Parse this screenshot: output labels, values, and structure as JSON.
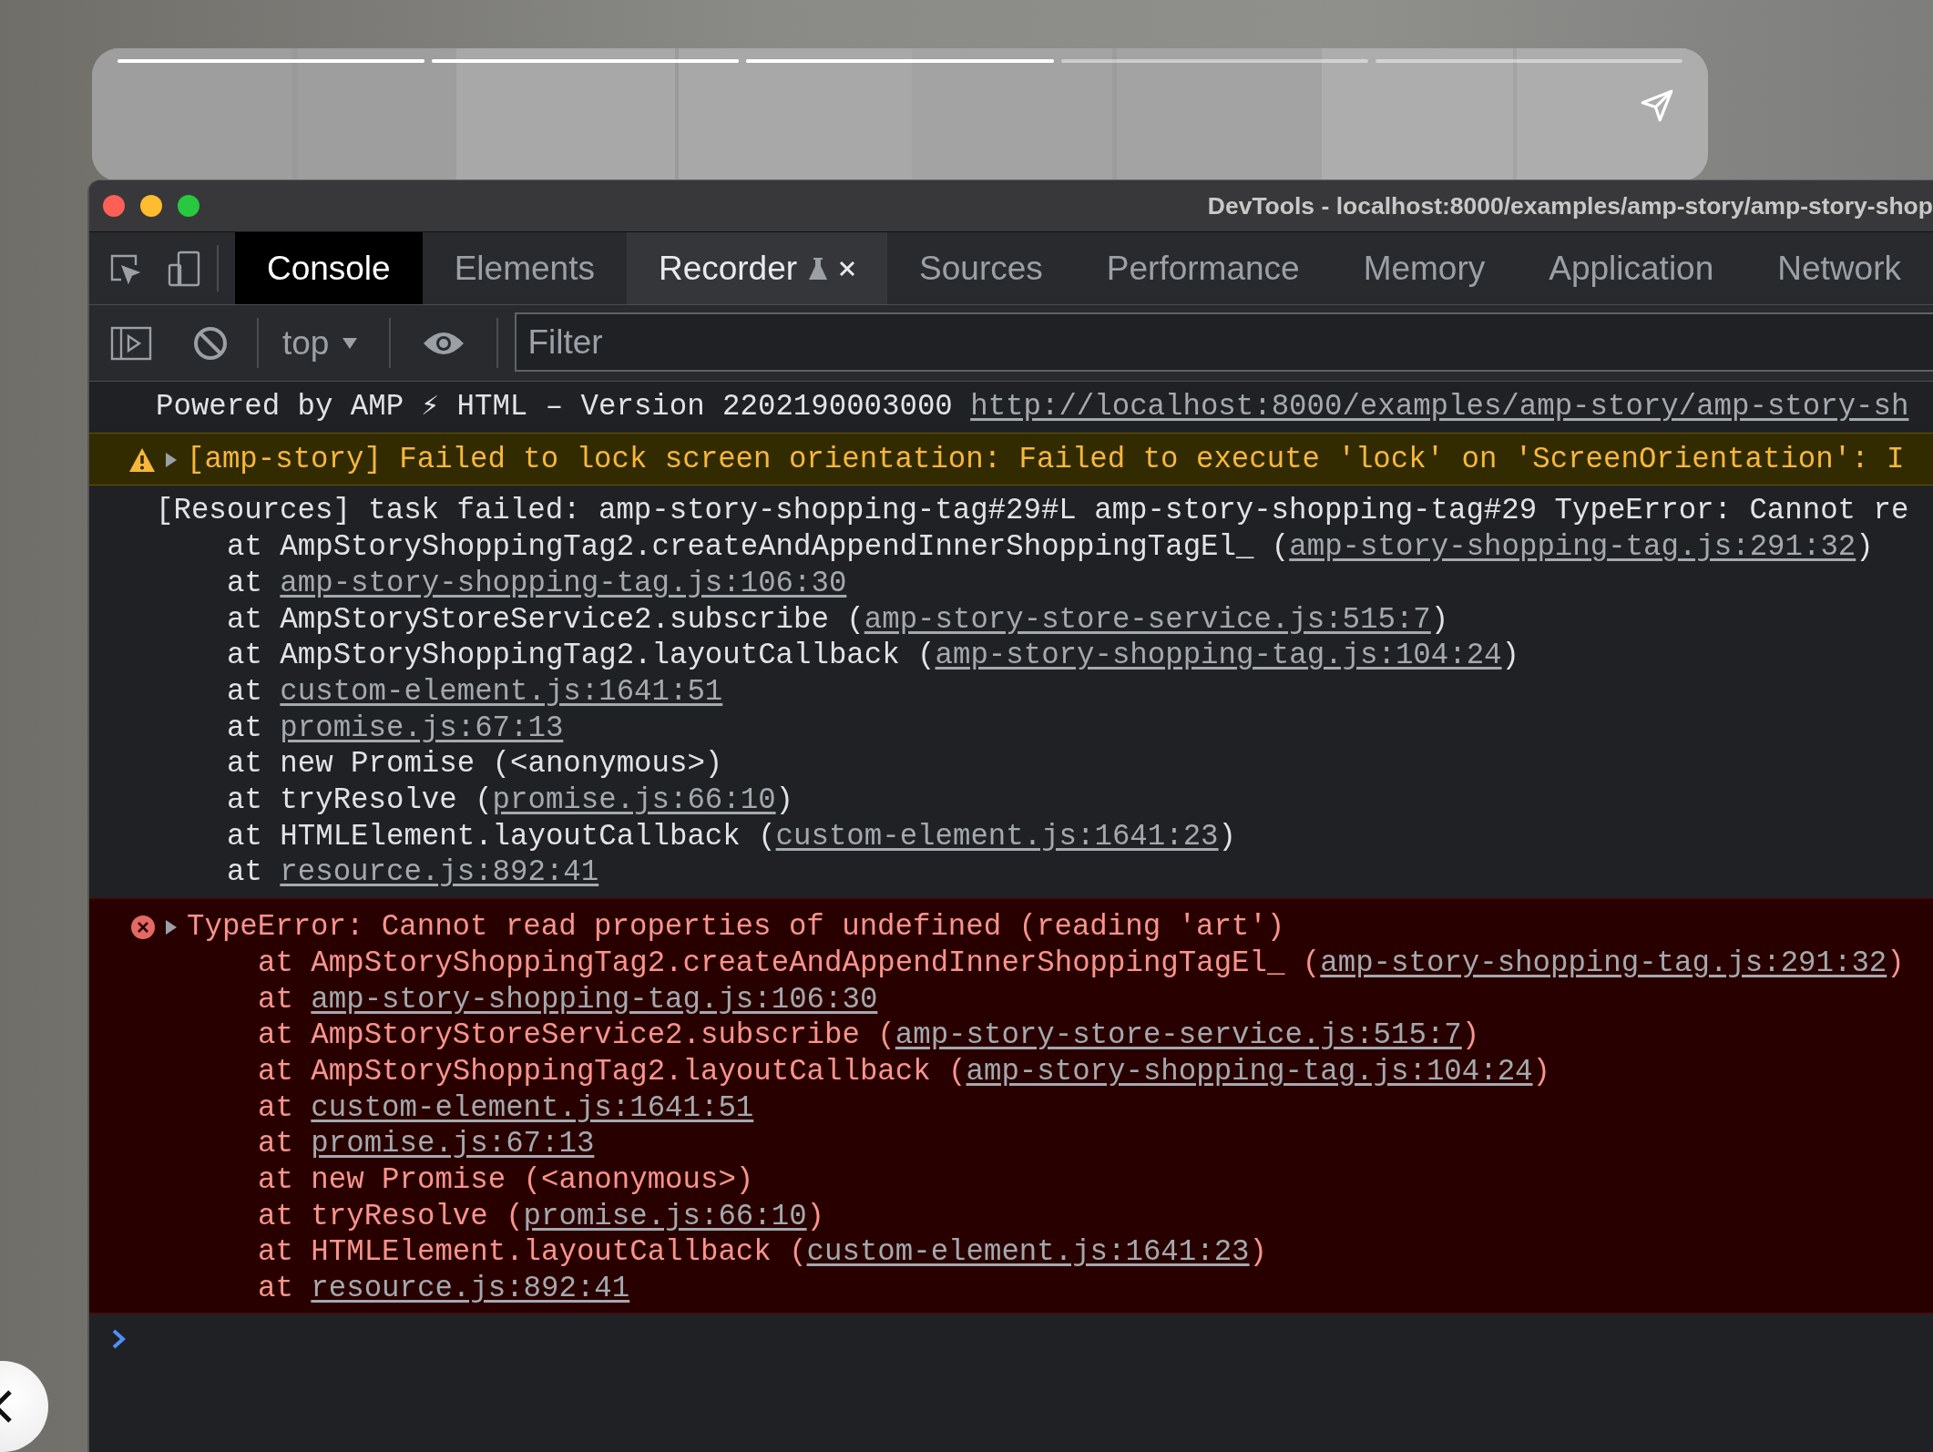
{
  "story": {
    "progress": [
      {
        "level": 1
      },
      {
        "level": 1
      },
      {
        "level": 1
      },
      {
        "level": 0
      },
      {
        "level": 0
      }
    ]
  },
  "devtools": {
    "title": "DevTools - localhost:8000/examples/amp-story/amp-story-shop",
    "tabs": [
      {
        "label": "Console",
        "selected": true,
        "hovered": false
      },
      {
        "label": "Elements",
        "selected": false,
        "hovered": false
      },
      {
        "label": "Recorder",
        "selected": false,
        "hovered": true,
        "experimental": true,
        "closable": true
      },
      {
        "label": "Sources",
        "selected": false,
        "hovered": false
      },
      {
        "label": "Performance",
        "selected": false,
        "hovered": false
      },
      {
        "label": "Memory",
        "selected": false,
        "hovered": false
      },
      {
        "label": "Application",
        "selected": false,
        "hovered": false
      },
      {
        "label": "Network",
        "selected": false,
        "hovered": false
      }
    ],
    "console_toolbar": {
      "context": "top",
      "filter": {
        "placeholder": "Filter"
      }
    },
    "messages": [
      {
        "kind": "info",
        "text": "Powered by AMP ⚡ HTML – Version 2202190003000 ",
        "link": "http://localhost:8000/examples/amp-story/amp-story-sh"
      },
      {
        "kind": "warning",
        "expanded": false,
        "text": "[amp-story] Failed to lock screen orientation: Failed to execute 'lock' on 'ScreenOrientation': I"
      },
      {
        "kind": "info",
        "text": "[Resources] task failed: amp-story-shopping-tag#29#L amp-story-shopping-tag#29 TypeError: Cannot re",
        "stack": [
          {
            "before": "at AmpStoryShoppingTag2.createAndAppendInnerShoppingTagEl_ (",
            "link": "amp-story-shopping-tag.js:291:32",
            "after": ")"
          },
          {
            "before": "at ",
            "link": "amp-story-shopping-tag.js:106:30"
          },
          {
            "before": "at AmpStoryStoreService2.subscribe (",
            "link": "amp-story-store-service.js:515:7",
            "after": ")"
          },
          {
            "before": "at AmpStoryShoppingTag2.layoutCallback (",
            "link": "amp-story-shopping-tag.js:104:24",
            "after": ")"
          },
          {
            "before": "at ",
            "link": "custom-element.js:1641:51"
          },
          {
            "before": "at ",
            "link": "promise.js:67:13"
          },
          {
            "before": "at new Promise (<anonymous>)"
          },
          {
            "before": "at tryResolve (",
            "link": "promise.js:66:10",
            "after": ")"
          },
          {
            "before": "at HTMLElement.layoutCallback (",
            "link": "custom-element.js:1641:23",
            "after": ")"
          },
          {
            "before": "at ",
            "link": "resource.js:892:41"
          }
        ]
      },
      {
        "kind": "error",
        "expanded": false,
        "text": "TypeError: Cannot read properties of undefined (reading 'art')",
        "stack": [
          {
            "before": "at AmpStoryShoppingTag2.createAndAppendInnerShoppingTagEl_ (",
            "link": "amp-story-shopping-tag.js:291:32",
            "after": ")"
          },
          {
            "before": "at ",
            "link": "amp-story-shopping-tag.js:106:30"
          },
          {
            "before": "at AmpStoryStoreService2.subscribe (",
            "link": "amp-story-store-service.js:515:7",
            "after": ")"
          },
          {
            "before": "at AmpStoryShoppingTag2.layoutCallback (",
            "link": "amp-story-shopping-tag.js:104:24",
            "after": ")"
          },
          {
            "before": "at ",
            "link": "custom-element.js:1641:51"
          },
          {
            "before": "at ",
            "link": "promise.js:67:13"
          },
          {
            "before": "at new Promise (<anonymous>)"
          },
          {
            "before": "at tryResolve (",
            "link": "promise.js:66:10",
            "after": ")"
          },
          {
            "before": "at HTMLElement.layoutCallback (",
            "link": "custom-element.js:1641:23",
            "after": ")"
          },
          {
            "before": "at ",
            "link": "resource.js:892:41"
          }
        ]
      }
    ]
  }
}
